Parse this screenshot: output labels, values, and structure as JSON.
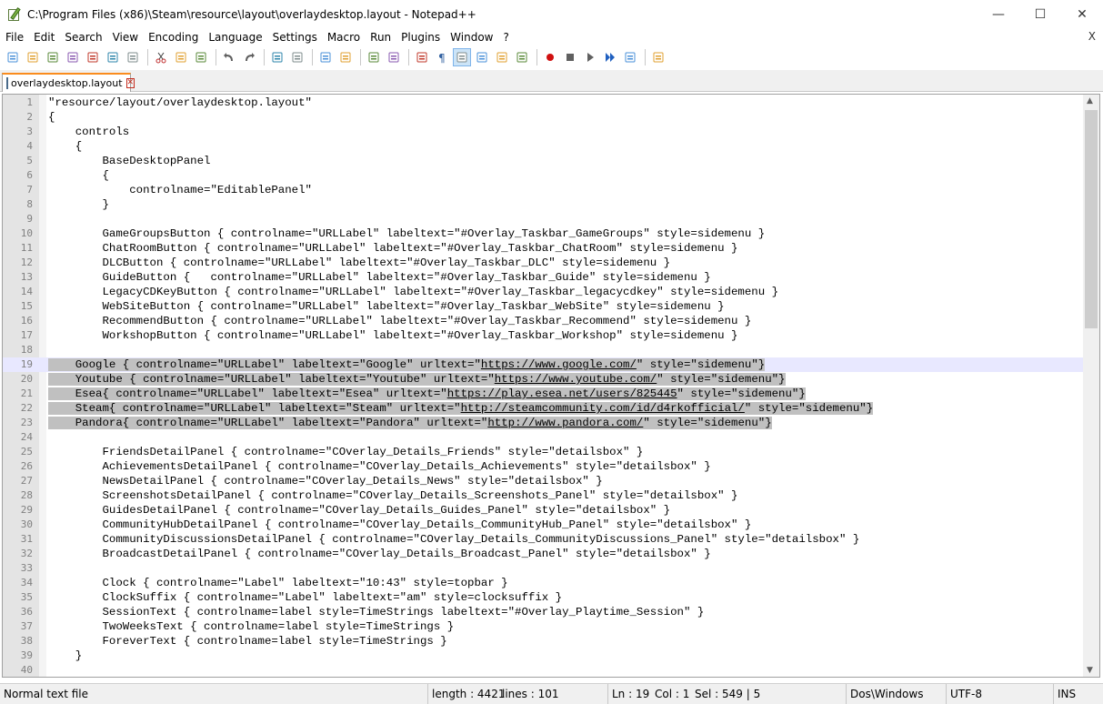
{
  "window": {
    "title": "C:\\Program Files (x86)\\Steam\\resource\\layout\\overlaydesktop.layout - Notepad++",
    "minimize": "—",
    "maximize": "☐",
    "close": "✕"
  },
  "menu": {
    "items": [
      "File",
      "Edit",
      "Search",
      "View",
      "Encoding",
      "Language",
      "Settings",
      "Macro",
      "Run",
      "Plugins",
      "Window",
      "?"
    ],
    "close_doc": "X"
  },
  "toolbar": {
    "icons": [
      "new-file-icon",
      "open-file-icon",
      "save-icon",
      "save-all-icon",
      "close-icon",
      "close-all-icon",
      "print-icon",
      "cut-icon",
      "copy-icon",
      "paste-icon",
      "undo-icon",
      "redo-icon",
      "find-icon",
      "replace-icon",
      "zoom-in-icon",
      "zoom-out-icon",
      "sync-vertical-icon",
      "sync-horizontal-icon",
      "word-wrap-icon",
      "show-all-chars-icon",
      "indent-guide-icon",
      "doc-map-icon",
      "function-list-icon",
      "folder-workspace-icon",
      "record-macro-icon",
      "stop-record-icon",
      "play-macro-icon",
      "run-macro-multiple-icon",
      "save-macro-icon",
      "monitoring-icon"
    ]
  },
  "tab": {
    "label": "overlaydesktop.layout",
    "close": "✕"
  },
  "editor": {
    "lines": [
      "\"resource/layout/overlaydesktop.layout\"",
      "{",
      "    controls",
      "    {",
      "        BaseDesktopPanel",
      "        {",
      "            controlname=\"EditablePanel\"",
      "        }",
      "",
      "        GameGroupsButton { controlname=\"URLLabel\" labeltext=\"#Overlay_Taskbar_GameGroups\" style=sidemenu }",
      "        ChatRoomButton { controlname=\"URLLabel\" labeltext=\"#Overlay_Taskbar_ChatRoom\" style=sidemenu }",
      "        DLCButton { controlname=\"URLLabel\" labeltext=\"#Overlay_Taskbar_DLC\" style=sidemenu }",
      "        GuideButton {   controlname=\"URLLabel\" labeltext=\"#Overlay_Taskbar_Guide\" style=sidemenu }",
      "        LegacyCDKeyButton { controlname=\"URLLabel\" labeltext=\"#Overlay_Taskbar_legacycdkey\" style=sidemenu }",
      "        WebSiteButton { controlname=\"URLLabel\" labeltext=\"#Overlay_Taskbar_WebSite\" style=sidemenu }",
      "        RecommendButton { controlname=\"URLLabel\" labeltext=\"#Overlay_Taskbar_Recommend\" style=sidemenu }",
      "        WorkshopButton { controlname=\"URLLabel\" labeltext=\"#Overlay_Taskbar_Workshop\" style=sidemenu }",
      "",
      "    Google { controlname=\"URLLabel\" labeltext=\"Google\" urltext=\"https://www.google.com/\" style=\"sidemenu\"}",
      "    Youtube { controlname=\"URLLabel\" labeltext=\"Youtube\" urltext=\"https://www.youtube.com/\" style=\"sidemenu\"}",
      "    Esea{ controlname=\"URLLabel\" labeltext=\"Esea\" urltext=\"https://play.esea.net/users/825445\" style=\"sidemenu\"}",
      "    Steam{ controlname=\"URLLabel\" labeltext=\"Steam\" urltext=\"http://steamcommunity.com/id/d4rkofficial/\" style=\"sidemenu\"}",
      "    Pandora{ controlname=\"URLLabel\" labeltext=\"Pandora\" urltext=\"http://www.pandora.com/\" style=\"sidemenu\"}",
      "",
      "        FriendsDetailPanel { controlname=\"COverlay_Details_Friends\" style=\"detailsbox\" }",
      "        AchievementsDetailPanel { controlname=\"COverlay_Details_Achievements\" style=\"detailsbox\" }",
      "        NewsDetailPanel { controlname=\"COverlay_Details_News\" style=\"detailsbox\" }",
      "        ScreenshotsDetailPanel { controlname=\"COverlay_Details_Screenshots_Panel\" style=\"detailsbox\" }",
      "        GuidesDetailPanel { controlname=\"COverlay_Details_Guides_Panel\" style=\"detailsbox\" }",
      "        CommunityHubDetailPanel { controlname=\"COverlay_Details_CommunityHub_Panel\" style=\"detailsbox\" }",
      "        CommunityDiscussionsDetailPanel { controlname=\"COverlay_Details_CommunityDiscussions_Panel\" style=\"detailsbox\" }",
      "        BroadcastDetailPanel { controlname=\"COverlay_Details_Broadcast_Panel\" style=\"detailsbox\" }",
      "",
      "        Clock { controlname=\"Label\" labeltext=\"10:43\" style=topbar }",
      "        ClockSuffix { controlname=\"Label\" labeltext=\"am\" style=clocksuffix }",
      "        SessionText { controlname=label style=TimeStrings labeltext=\"#Overlay_Playtime_Session\" }",
      "        TwoWeeksText { controlname=label style=TimeStrings }",
      "        ForeverText { controlname=label style=TimeStrings }",
      "    }",
      ""
    ],
    "selected_lines": [
      19,
      20,
      21,
      22,
      23
    ],
    "current_line": 19,
    "urls": [
      "https://www.google.com/",
      "https://www.youtube.com/",
      "https://play.esea.net/users/825445",
      "http://steamcommunity.com/id/d4rkofficial/",
      "http://www.pandora.com/"
    ]
  },
  "status": {
    "file_type": "Normal text file",
    "length": "length : 4421",
    "lines": "lines : 101",
    "ln": "Ln : 19",
    "col": "Col : 1",
    "sel": "Sel : 549 | 5",
    "eol": "Dos\\Windows",
    "encoding": "UTF-8",
    "mode": "INS"
  },
  "colors": {
    "tab_accent": "#fa8c1e",
    "selection": "#c0c0c0",
    "current_line": "#e8e8ff",
    "gutter": "#e4e4e4"
  }
}
